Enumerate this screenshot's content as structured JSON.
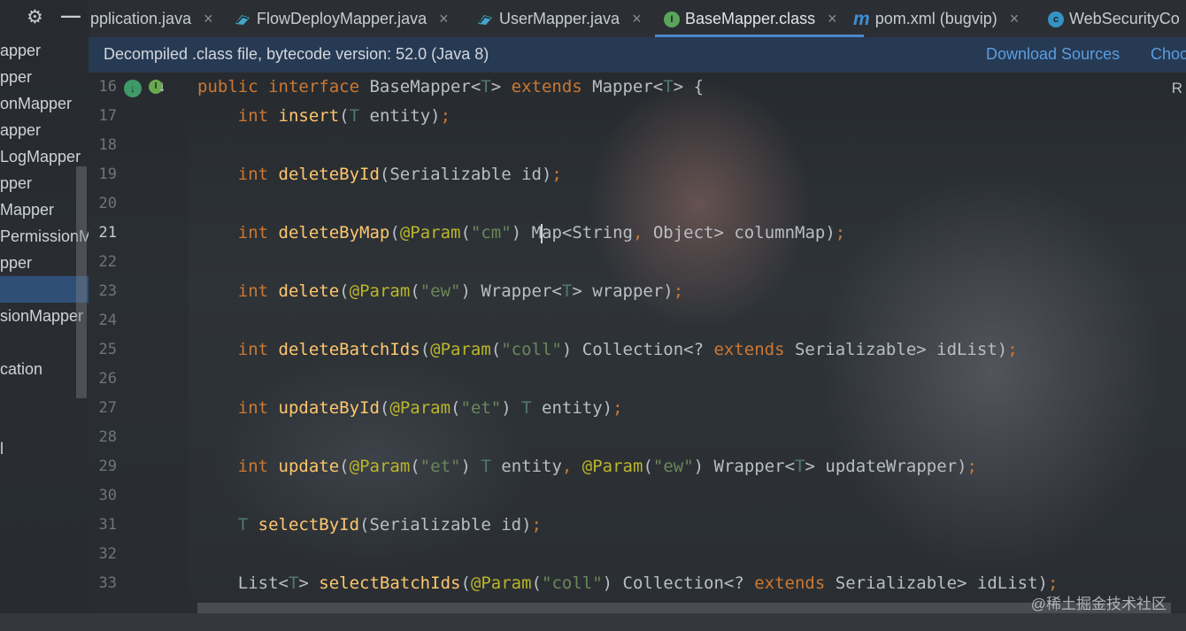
{
  "project_panel": {
    "items": [
      "apper",
      "pper",
      "onMapper",
      "apper",
      "LogMapper",
      "pper",
      "Mapper",
      "PermissionM",
      "pper",
      "",
      "sionMapper",
      "",
      "cation",
      "",
      "",
      "l",
      "",
      "",
      "",
      "",
      ""
    ]
  },
  "tabs": [
    {
      "label": "pplication.java",
      "icon": "java-file-icon",
      "active": false
    },
    {
      "label": "FlowDeployMapper.java",
      "icon": "java-file-icon",
      "active": false
    },
    {
      "label": "UserMapper.java",
      "icon": "java-file-icon",
      "active": false
    },
    {
      "label": "BaseMapper.class",
      "icon": "interface-class-icon",
      "active": true
    },
    {
      "label": "pom.xml (bugvip)",
      "icon": "maven-icon",
      "active": false
    },
    {
      "label": "WebSecurityCo",
      "icon": "class-icon",
      "active": false
    }
  ],
  "banner": {
    "text": "Decompiled .class file, bytecode version: 52.0 (Java 8)",
    "download_sources": "Download Sources",
    "choose_sources": "Choo"
  },
  "editor": {
    "line_numbers": [
      "16",
      "17",
      "18",
      "19",
      "20",
      "21",
      "22",
      "23",
      "24",
      "25",
      "26",
      "27",
      "28",
      "29",
      "30",
      "31",
      "32",
      "33"
    ],
    "current_line": "21",
    "reader_mode": "R",
    "lines": [
      [
        [
          "kw",
          "public "
        ],
        [
          "kw",
          "interface "
        ],
        [
          "pl",
          "BaseMapper<"
        ],
        [
          "tp",
          "T"
        ],
        [
          "pl",
          "> "
        ],
        [
          "kw",
          "extends "
        ],
        [
          "pl",
          "Mapper<"
        ],
        [
          "tp",
          "T"
        ],
        [
          "pl",
          "> {"
        ]
      ],
      [
        [
          "pl",
          "    "
        ],
        [
          "kw",
          "int "
        ],
        [
          "fn",
          "insert"
        ],
        [
          "pl",
          "("
        ],
        [
          "tp",
          "T"
        ],
        [
          "pl",
          " entity)"
        ],
        [
          "kw",
          ";"
        ]
      ],
      [],
      [
        [
          "pl",
          "    "
        ],
        [
          "kw",
          "int "
        ],
        [
          "fn",
          "deleteById"
        ],
        [
          "pl",
          "(Serializable id)"
        ],
        [
          "kw",
          ";"
        ]
      ],
      [],
      [
        [
          "pl",
          "    "
        ],
        [
          "kw",
          "int "
        ],
        [
          "fn",
          "deleteByMap"
        ],
        [
          "pl",
          "("
        ],
        [
          "ann",
          "@Param"
        ],
        [
          "pl",
          "("
        ],
        [
          "str",
          "\"cm\""
        ],
        [
          "pl",
          ") M"
        ],
        [
          "caret",
          ""
        ],
        [
          "pl",
          "ap<String"
        ],
        [
          "kw",
          ", "
        ],
        [
          "pl",
          "Object> columnMap)"
        ],
        [
          "kw",
          ";"
        ]
      ],
      [],
      [
        [
          "pl",
          "    "
        ],
        [
          "kw",
          "int "
        ],
        [
          "fn",
          "delete"
        ],
        [
          "pl",
          "("
        ],
        [
          "ann",
          "@Param"
        ],
        [
          "pl",
          "("
        ],
        [
          "str",
          "\"ew\""
        ],
        [
          "pl",
          ") Wrapper<"
        ],
        [
          "tp",
          "T"
        ],
        [
          "pl",
          "> wrapper)"
        ],
        [
          "kw",
          ";"
        ]
      ],
      [],
      [
        [
          "pl",
          "    "
        ],
        [
          "kw",
          "int "
        ],
        [
          "fn",
          "deleteBatchIds"
        ],
        [
          "pl",
          "("
        ],
        [
          "ann",
          "@Param"
        ],
        [
          "pl",
          "("
        ],
        [
          "str",
          "\"coll\""
        ],
        [
          "pl",
          ") Collection<? "
        ],
        [
          "kw",
          "extends "
        ],
        [
          "pl",
          "Serializable> idList)"
        ],
        [
          "kw",
          ";"
        ]
      ],
      [],
      [
        [
          "pl",
          "    "
        ],
        [
          "kw",
          "int "
        ],
        [
          "fn",
          "updateById"
        ],
        [
          "pl",
          "("
        ],
        [
          "ann",
          "@Param"
        ],
        [
          "pl",
          "("
        ],
        [
          "str",
          "\"et\""
        ],
        [
          "pl",
          ") "
        ],
        [
          "tp",
          "T"
        ],
        [
          "pl",
          " entity)"
        ],
        [
          "kw",
          ";"
        ]
      ],
      [],
      [
        [
          "pl",
          "    "
        ],
        [
          "kw",
          "int "
        ],
        [
          "fn",
          "update"
        ],
        [
          "pl",
          "("
        ],
        [
          "ann",
          "@Param"
        ],
        [
          "pl",
          "("
        ],
        [
          "str",
          "\"et\""
        ],
        [
          "pl",
          ") "
        ],
        [
          "tp",
          "T"
        ],
        [
          "pl",
          " entity"
        ],
        [
          "kw",
          ", "
        ],
        [
          "ann",
          "@Param"
        ],
        [
          "pl",
          "("
        ],
        [
          "str",
          "\"ew\""
        ],
        [
          "pl",
          ") Wrapper<"
        ],
        [
          "tp",
          "T"
        ],
        [
          "pl",
          "> updateWrapper)"
        ],
        [
          "kw",
          ";"
        ]
      ],
      [],
      [
        [
          "pl",
          "    "
        ],
        [
          "tp",
          "T "
        ],
        [
          "fn",
          "selectById"
        ],
        [
          "pl",
          "(Serializable id)"
        ],
        [
          "kw",
          ";"
        ]
      ],
      [],
      [
        [
          "pl",
          "    List<"
        ],
        [
          "tp",
          "T"
        ],
        [
          "pl",
          "> "
        ],
        [
          "fn",
          "selectBatchIds"
        ],
        [
          "pl",
          "("
        ],
        [
          "ann",
          "@Param"
        ],
        [
          "pl",
          "("
        ],
        [
          "str",
          "\"coll\""
        ],
        [
          "pl",
          ") Collection<? "
        ],
        [
          "kw",
          "extends "
        ],
        [
          "pl",
          "Serializable> idList)"
        ],
        [
          "kw",
          ";"
        ]
      ]
    ]
  },
  "watermark": "@稀土掘金技术社区",
  "colors": {
    "keyword": "#cc7832",
    "method": "#ffc66d",
    "annotation": "#bbb529",
    "string": "#6a8759",
    "type_param": "#507874",
    "link": "#5a9de0",
    "tab_underline": "#4a88c7"
  }
}
